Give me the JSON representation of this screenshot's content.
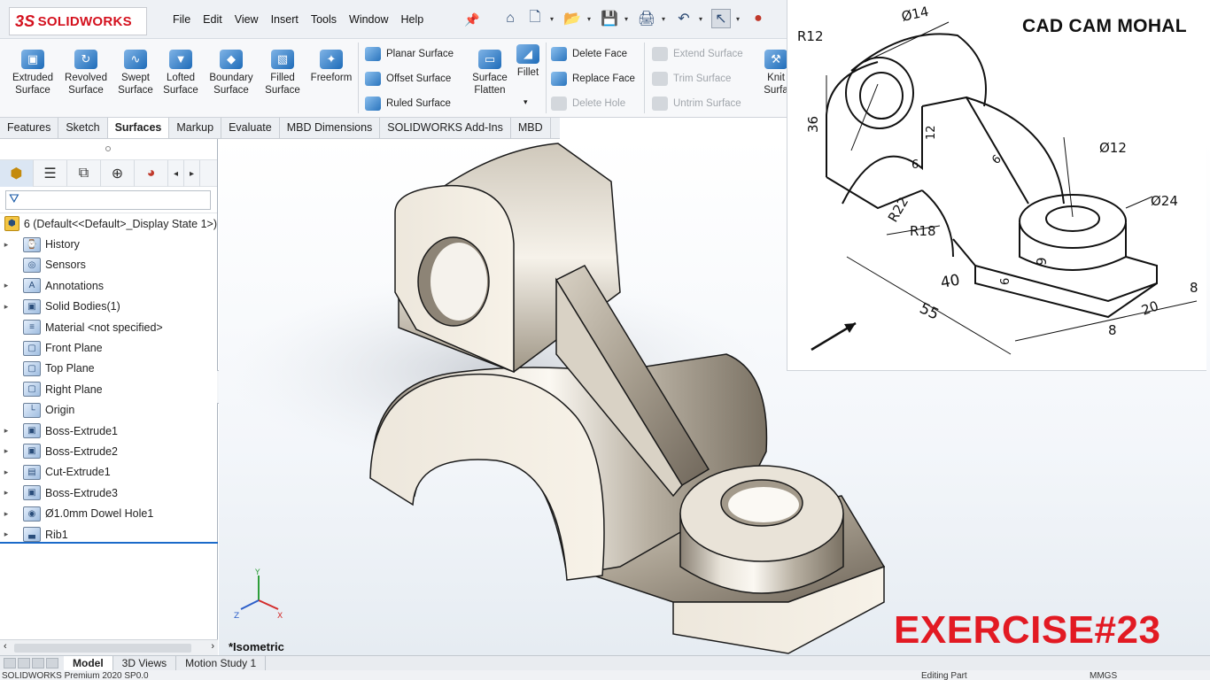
{
  "app": {
    "logo_ds": "3S",
    "logo_text": "SOLIDWORKS"
  },
  "menu": [
    "File",
    "Edit",
    "View",
    "Insert",
    "Tools",
    "Window",
    "Help"
  ],
  "ribbon": {
    "extruded": "Extruded Surface",
    "revolved": "Revolved Surface",
    "swept": "Swept Surface",
    "lofted": "Lofted Surface",
    "boundary": "Boundary Surface",
    "filled": "Filled Surface",
    "freeform": "Freeform",
    "planar": "Planar Surface",
    "offset": "Offset Surface",
    "ruled": "Ruled Surface",
    "flatten": "Surface Flatten",
    "fillet": "Fillet",
    "delete_face": "Delete Face",
    "replace_face": "Replace Face",
    "delete_hole": "Delete Hole",
    "extend": "Extend Surface",
    "trim": "Trim Surface",
    "untrim": "Untrim Surface",
    "knit": "Knit Surfa"
  },
  "tabs": [
    {
      "label": "Features",
      "active": false
    },
    {
      "label": "Sketch",
      "active": false
    },
    {
      "label": "Surfaces",
      "active": true
    },
    {
      "label": "Markup",
      "active": false
    },
    {
      "label": "Evaluate",
      "active": false
    },
    {
      "label": "MBD Dimensions",
      "active": false
    },
    {
      "label": "SOLIDWORKS Add-Ins",
      "active": false
    },
    {
      "label": "MBD",
      "active": false
    }
  ],
  "tree": {
    "root": "6  (Default<<Default>_Display State 1>)",
    "items": [
      {
        "label": "History",
        "expand": true,
        "icon": "history-icon"
      },
      {
        "label": "Sensors",
        "expand": false,
        "icon": "sensor-icon"
      },
      {
        "label": "Annotations",
        "expand": true,
        "icon": "annotation-icon"
      },
      {
        "label": "Solid Bodies(1)",
        "expand": true,
        "icon": "solid-body-icon"
      },
      {
        "label": "Material <not specified>",
        "expand": false,
        "icon": "material-icon"
      },
      {
        "label": "Front Plane",
        "expand": false,
        "icon": "plane-icon"
      },
      {
        "label": "Top Plane",
        "expand": false,
        "icon": "plane-icon"
      },
      {
        "label": "Right Plane",
        "expand": false,
        "icon": "plane-icon"
      },
      {
        "label": "Origin",
        "expand": false,
        "icon": "origin-icon"
      },
      {
        "label": "Boss-Extrude1",
        "expand": true,
        "icon": "extrude-icon"
      },
      {
        "label": "Boss-Extrude2",
        "expand": true,
        "icon": "extrude-icon"
      },
      {
        "label": "Cut-Extrude1",
        "expand": true,
        "icon": "cut-extrude-icon"
      },
      {
        "label": "Boss-Extrude3",
        "expand": true,
        "icon": "extrude-icon"
      },
      {
        "label": "Ø1.0mm Dowel Hole1",
        "expand": true,
        "icon": "hole-icon"
      },
      {
        "label": "Rib1",
        "expand": true,
        "icon": "rib-icon"
      }
    ]
  },
  "viewport": {
    "view_label": "*Isometric",
    "exercise": "EXERCISE#23",
    "triad": {
      "y": "Y",
      "x": "X",
      "z": "Z"
    }
  },
  "inset": {
    "title": "CAD CAM MOHAL",
    "dims": {
      "d14": "Ø14",
      "r12": "R12",
      "h36": "36",
      "t12": "12",
      "t6a": "6",
      "t6b": "6",
      "d12": "Ø12",
      "r22": "R22",
      "r18": "R18",
      "d24": "Ø24",
      "h9": "9",
      "h6": "6",
      "l40": "40",
      "l55": "55",
      "w8a": "8",
      "w20": "20",
      "w8b": "8"
    }
  },
  "bottom_tabs": [
    {
      "label": "Model",
      "active": true
    },
    {
      "label": "3D Views",
      "active": false
    },
    {
      "label": "Motion Study 1",
      "active": false
    }
  ],
  "status": {
    "product": "SOLIDWORKS Premium 2020 SP0.0",
    "mode": "Editing Part",
    "units": "MMGS"
  },
  "colors": {
    "brand_red": "#d4111e",
    "exercise_red": "#e21a23",
    "accent_blue": "#1b6ac9"
  }
}
